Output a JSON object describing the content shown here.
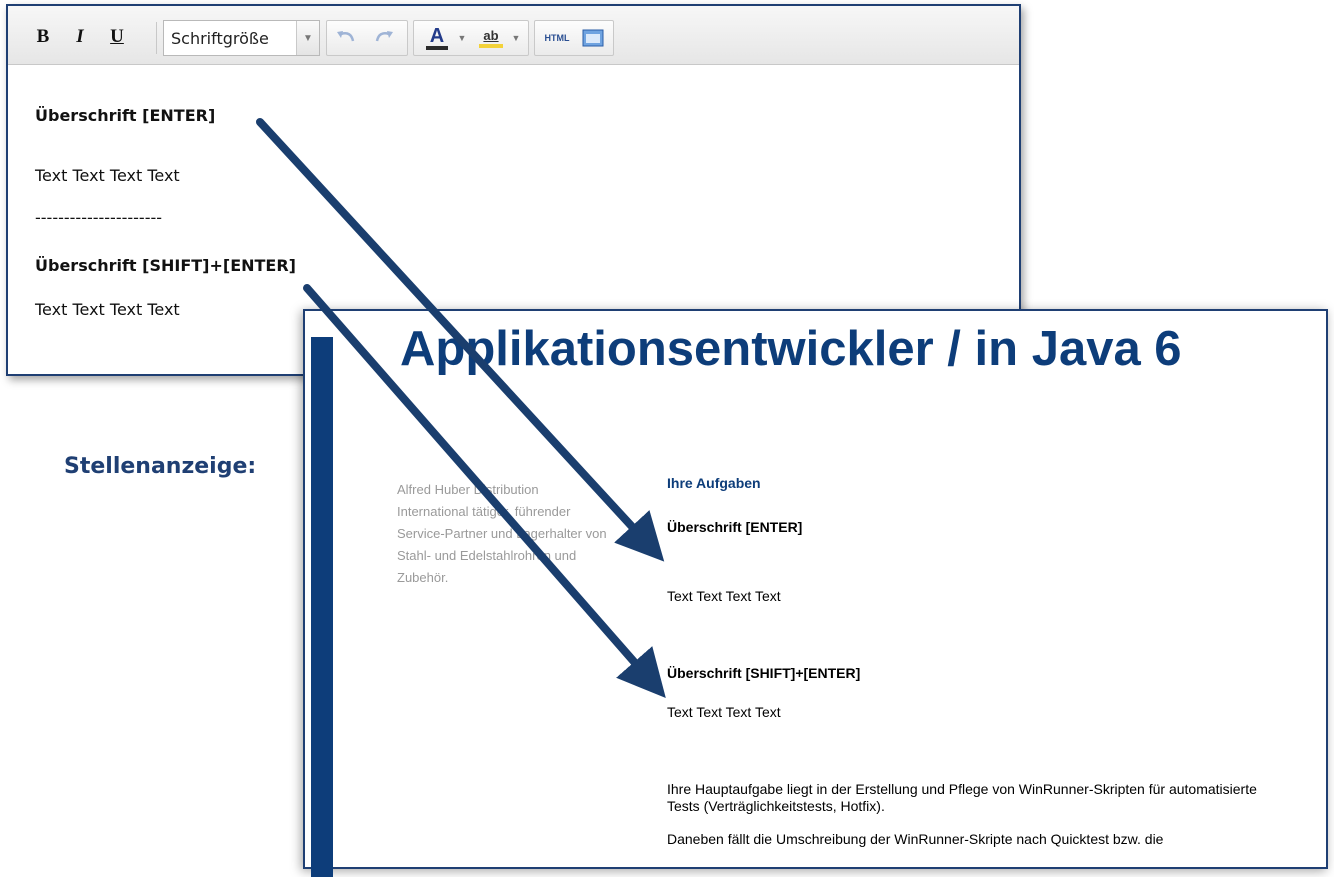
{
  "toolbar": {
    "bold_label": "B",
    "italic_label": "I",
    "underline_label": "U",
    "font_size_label": "Schriftgröße",
    "html_label": "HTML",
    "text_color_label": "A",
    "highlight_label": "ab"
  },
  "editor": {
    "lines": [
      "Überschrift [ENTER]",
      "Text Text Text Text",
      "----------------------",
      "Überschrift [SHIFT]+[ENTER]",
      "Text Text Text Text"
    ]
  },
  "side_label": "Stellenanzeige:",
  "ad": {
    "title": "Applikationsentwickler / in Java 6",
    "company_lines": [
      "Alfred Huber Distribution",
      "International tätiger, führender",
      "Service-Partner und Lagerhalter von",
      "Stahl- und Edelstahlrohren und",
      "Zubehör."
    ],
    "section_title": "Ihre Aufgaben",
    "heading_1": "Überschrift [ENTER]",
    "text_1": "Text Text Text Text",
    "heading_2": "Überschrift [SHIFT]+[ENTER]",
    "text_2": "Text Text Text Text",
    "paragraph_1": "Ihre Hauptaufgabe liegt in der Erstellung und Pflege von WinRunner-Skripten für automatisierte Tests (Verträglichkeitstests, Hotfix).",
    "paragraph_2": "Daneben fällt die Umschreibung der WinRunner-Skripte nach Quicktest bzw. die"
  },
  "colors": {
    "brand_blue": "#0d3d7a",
    "arrow": "#1a3e6e",
    "company_text": "#9a9a9a"
  }
}
